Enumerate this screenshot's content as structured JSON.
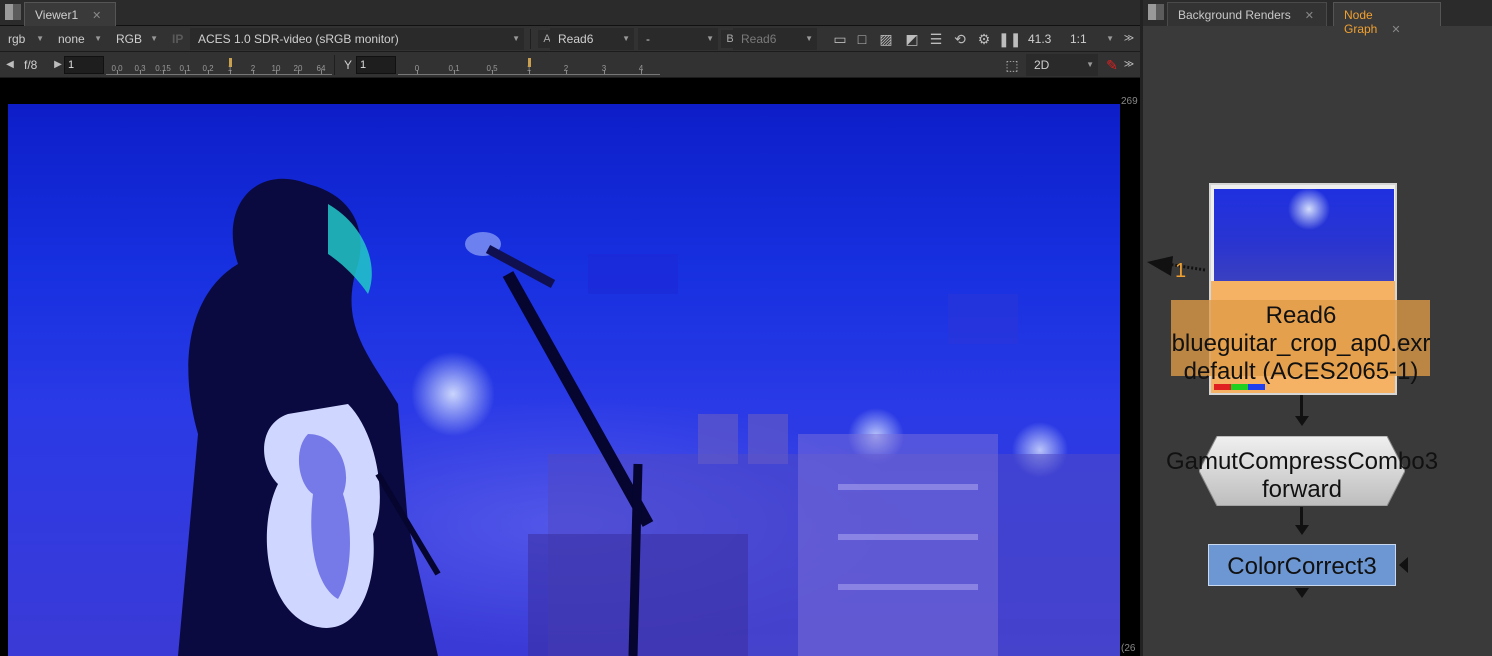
{
  "viewer": {
    "tab_title": "Viewer1",
    "close_glyph": "✕",
    "toolbar1": {
      "channels": "rgb",
      "alpha": "none",
      "display_channels": "RGB",
      "ip_label": "IP",
      "view_transform": "ACES 1.0 SDR-video (sRGB monitor)",
      "a_label": "A",
      "a_input": "Read6",
      "compare_mode": "-",
      "b_label": "B",
      "b_input": "Read6",
      "zoom_percent": "41.3",
      "proxy_ratio": "1:1"
    },
    "toolbar2": {
      "fstop": "f/8",
      "gain_value": "1",
      "gain_ticks": [
        "0.0",
        "0.3",
        "0.15",
        "0.1",
        "0.2",
        "1",
        "2",
        "10",
        "20",
        "64"
      ],
      "gamma_label": "Y",
      "gamma_value": "1",
      "gamma_ticks": [
        "0",
        "0.1",
        "0.5",
        "1",
        "2",
        "3",
        "4"
      ],
      "view_mode": "2D"
    },
    "format_top": "269",
    "format_bottom": "(26"
  },
  "graph": {
    "tabs": [
      {
        "label": "Background Renders",
        "active": false
      },
      {
        "label": "Node Graph",
        "active": true
      }
    ],
    "close_glyph": "✕",
    "input_number": "1",
    "nodes": {
      "read": {
        "name": "Read6",
        "file": "blueguitar_crop_ap0.exr",
        "colorspace": "default (ACES2065-1)"
      },
      "gamut": {
        "name": "GamutCompressCombo3",
        "direction": "forward"
      },
      "cc": {
        "name": "ColorCorrect3"
      }
    }
  },
  "colors": {
    "accent_tab": "#f0a030",
    "read_node": "#f5b164",
    "cc_node": "#6d97d2",
    "gamut_node": "#d8d8d8"
  }
}
